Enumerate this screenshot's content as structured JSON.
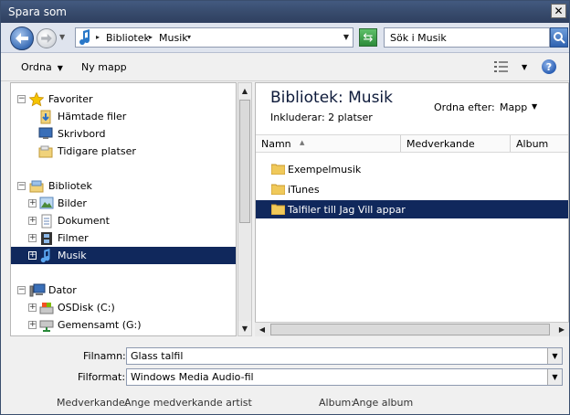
{
  "window": {
    "title": "Spara som"
  },
  "address": {
    "crumbs": [
      "Bibliotek",
      "Musik"
    ]
  },
  "search": {
    "placeholder": "Sök i Musik"
  },
  "toolbar": {
    "organize": "Ordna",
    "new_folder": "Ny mapp"
  },
  "nav": {
    "favorites": {
      "label": "Favoriter",
      "items": [
        "Hämtade filer",
        "Skrivbord",
        "Tidigare platser"
      ]
    },
    "libraries": {
      "label": "Bibliotek",
      "items": [
        "Bilder",
        "Dokument",
        "Filmer",
        "Musik"
      ]
    },
    "computer": {
      "label": "Dator",
      "items": [
        "OSDisk (C:)",
        "Gemensamt (G:)"
      ]
    }
  },
  "content": {
    "title": "Bibliotek: Musik",
    "includes_label": "Inkluderar:",
    "includes_value": "2 platser",
    "sort_label": "Ordna efter:",
    "sort_value": "Mapp",
    "columns": [
      "Namn",
      "Medverkande",
      "Album"
    ],
    "files": [
      "Exempelmusik",
      "iTunes",
      "Talfiler till Jag Vill appar"
    ]
  },
  "form": {
    "filename_label": "Filnamn:",
    "filename_value": "Glass talfil",
    "format_label": "Filformat:",
    "format_value": "Windows Media Audio-fil",
    "artist_label": "Medverkande:",
    "artist_value": "Ange medverkande artist",
    "album_label": "Album:",
    "album_value": "Ange album"
  },
  "colors": {
    "selection": "#10285c",
    "titlebar": "#36496a"
  }
}
